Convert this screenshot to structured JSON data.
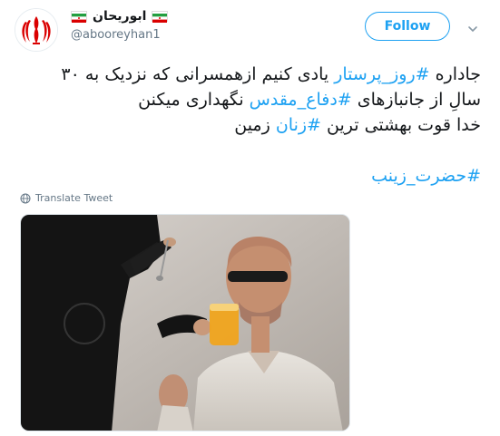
{
  "user": {
    "display_name": "ابوریحان",
    "handle": "@abooreyhan1",
    "flag_icon": "iran-flag-icon",
    "avatar_icon": "iran-emblem-icon"
  },
  "actions": {
    "follow_label": "Follow",
    "more_icon": "chevron-down-icon"
  },
  "tweet": {
    "line1_a": "جاداره ",
    "line1_tag": "#روز_پرستار",
    "line1_b": " یادی کنیم ازهمسرانی که نزدیک به ۳۰",
    "line2_a": "سالِ از جانبازهای ",
    "line2_tag": "#دفاع_مقدس",
    "line2_b": " نگهداری میکنن",
    "line3_a": "خدا قوت بهشتی ترین ",
    "line3_tag": "#زنان",
    "line3_b": " زمین",
    "hashtag_line": "#حضرت_زینب"
  },
  "translate_label": "Translate Tweet",
  "colors": {
    "accent": "#1da1f2",
    "text": "#14171a",
    "muted": "#657786",
    "flag_green": "#239f40",
    "flag_red": "#da0000"
  }
}
